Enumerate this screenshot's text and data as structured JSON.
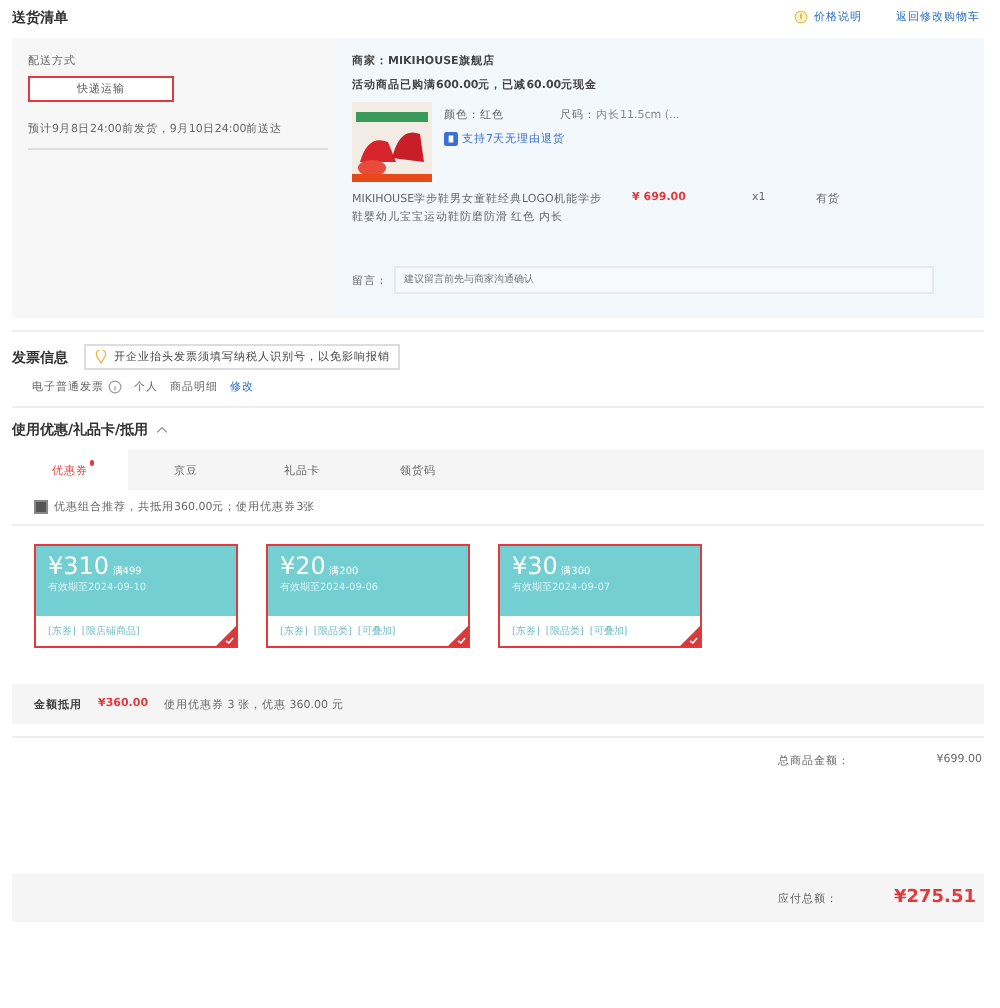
{
  "header": {
    "title": "送货清单",
    "price_note": "价格说明",
    "back_link": "返回修改购物车"
  },
  "delivery": {
    "label": "配送方式",
    "method": "快递运输",
    "selected": true,
    "estimate": "预计9月8日24:00前发货，9月10日24:00前送达"
  },
  "shop": {
    "merchant": "商家：MIKIHOUSE旗舰店",
    "promo": "活动商品已购满600.00元，已减60.00元现金",
    "product": {
      "color_attr": "颜色：红色",
      "size_label": "尺码：",
      "size": "内长11.5cm (...",
      "service": "支持7天无理由退货",
      "name": "MIKIHOUSE学步鞋男女童鞋经典LOGO机能学步鞋婴幼儿宝宝运动鞋防磨防滑 红色 内长",
      "price": "¥ 699.00",
      "qty": "x1",
      "stock": "有货"
    },
    "note_label": "留言：",
    "note_placeholder": "建议留言前先与商家沟通确认"
  },
  "invoice": {
    "title": "发票信息",
    "tip": "开企业抬头发票须填写纳税人识别号，以免影响报销",
    "type": "电子普通发票",
    "items": [
      "个人",
      "商品明细"
    ],
    "edit": "修改"
  },
  "discount": {
    "title": "使用优惠/礼品卡/抵用",
    "expanded": true,
    "tabs": [
      {
        "label": "优惠券",
        "selected": true,
        "dot": true
      },
      {
        "label": "京豆",
        "selected": false,
        "dot": false
      },
      {
        "label": "礼品卡",
        "selected": false,
        "dot": false
      },
      {
        "label": "领货码",
        "selected": false,
        "dot": false
      }
    ],
    "recommend": {
      "checked": true,
      "text": "优惠组合推荐，共抵用360.00元；使用优惠券3张"
    },
    "coupons": [
      {
        "amount": "¥310",
        "threshold": "满499",
        "expiry": "有效期至2024-09-10",
        "tags": [
          "[东券]",
          "[限店铺商品]"
        ],
        "selected": true
      },
      {
        "amount": "¥20",
        "threshold": "满200",
        "expiry": "有效期至2024-09-06",
        "tags": [
          "[东券]",
          "[限品类]",
          "[可叠加]"
        ],
        "selected": true
      },
      {
        "amount": "¥30",
        "threshold": "满300",
        "expiry": "有效期至2024-09-07",
        "tags": [
          "[东券]",
          "[限品类]",
          "[可叠加]"
        ],
        "selected": true
      }
    ],
    "summary_label": "金额抵用",
    "summary_amount": "¥360.00",
    "summary_text": "使用优惠券 3 张，优惠 360.00 元"
  },
  "totals": {
    "rows": [
      {
        "label": "总商品金额：",
        "value": "¥699.00"
      }
    ],
    "payable_label": "应付总额：",
    "payable": "¥275.51"
  }
}
